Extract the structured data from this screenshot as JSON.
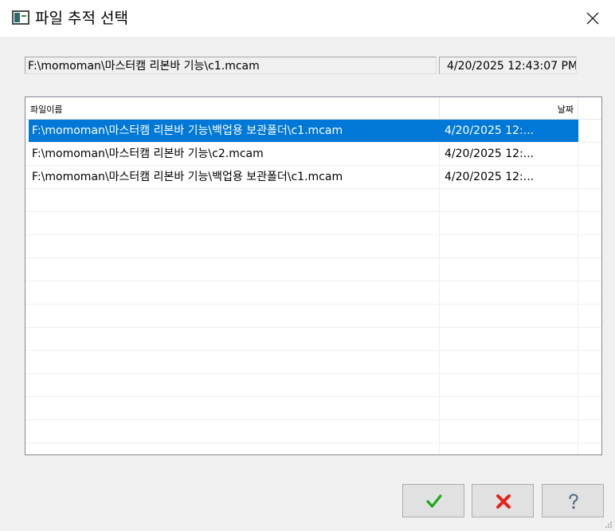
{
  "window": {
    "title": "파일 추적 선택",
    "icon": "dialog-app-icon",
    "close_icon": "close-icon"
  },
  "current": {
    "path": "F:\\momoman\\마스터캠 리본바 기능\\c1.mcam",
    "date": "4/20/2025 12:43:07 PM"
  },
  "list": {
    "columns": {
      "name": "파일이름",
      "date": "날짜"
    },
    "rows": [
      {
        "name": "F:\\momoman\\마스터캠 리본바 기능\\백업용 보관폴더\\c1.mcam",
        "date": "4/20/2025 12:...",
        "selected": true
      },
      {
        "name": "F:\\momoman\\마스터캠 리본바 기능\\c2.mcam",
        "date": "4/20/2025 12:...",
        "selected": false
      },
      {
        "name": "F:\\momoman\\마스터캠 리본바 기능\\백업용 보관폴더\\c1.mcam",
        "date": "4/20/2025 12:...",
        "selected": false
      }
    ]
  },
  "buttons": {
    "ok_icon": "checkmark-icon",
    "cancel_icon": "red-x-icon",
    "help_icon": "question-mark-icon"
  },
  "colors": {
    "selection": "#0078d7",
    "ok_green": "#1fa81f",
    "cancel_red": "#e8231b"
  }
}
